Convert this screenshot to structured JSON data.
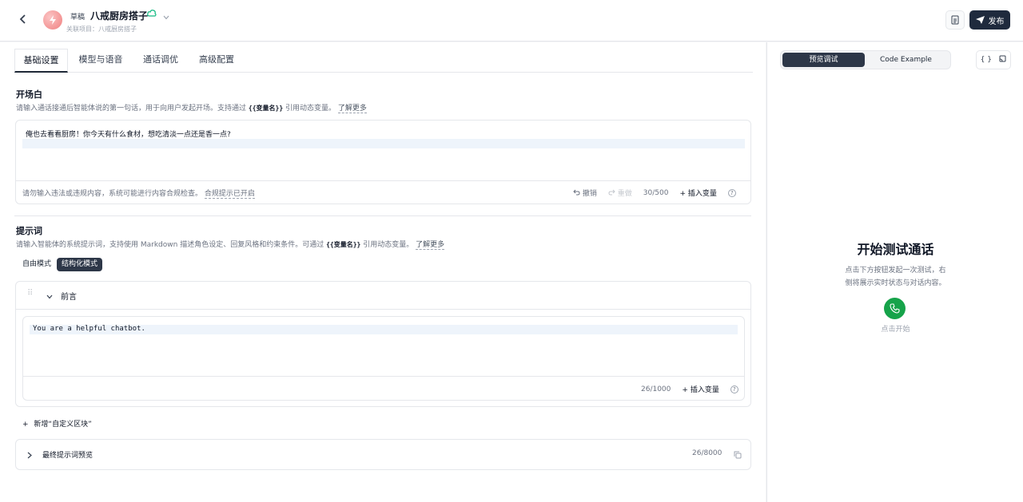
{
  "header": {
    "draft_badge": "草稿",
    "title": "八戒厨房搭子",
    "subtitle": "关联项目：八戒厨房搭子",
    "publish_label": "发布"
  },
  "tabs": [
    {
      "label": "基础设置",
      "active": true
    },
    {
      "label": "模型与语音",
      "active": false
    },
    {
      "label": "通话调优",
      "active": false
    },
    {
      "label": "高级配置",
      "active": false
    }
  ],
  "opening": {
    "title": "开场白",
    "desc_prefix": "请输入通话接通后智能体说的第一句话，用于向用户发起开场。支持通过",
    "var_syntax": "{{变量名}}",
    "desc_suffix": "引用动态变量。",
    "learn_more": "了解更多",
    "text": "俺也去看看厨房！你今天有什么食材，想吃清淡一点还是香一点?",
    "footer_note": "请勿输入违法或违规内容，系统可能进行内容合规检查。",
    "compliance_link": "合规提示已开启",
    "undo": "撤销",
    "redo": "重做",
    "count": "30/500",
    "insert_var": "插入变量"
  },
  "prompt": {
    "title": "提示词",
    "desc_prefix": "请输入智能体的系统提示词，支持使用 Markdown 描述角色设定、回复风格和约束条件。可通过",
    "var_syntax": "{{变量名}}",
    "desc_suffix": "引用动态变量。",
    "learn_more": "了解更多",
    "modes": [
      "自由模式",
      "结构化模式"
    ],
    "active_mode": "结构化模式",
    "block_title": "前言",
    "block_text": "You are a helpful chatbot.",
    "block_count": "26/1000",
    "insert_var": "插入变量",
    "add_block": "新增“自定义区块”",
    "preview_title": "最终提示词预览",
    "preview_count": "26/8000"
  },
  "right_panel": {
    "tabs": [
      "预览调试",
      "Code Example"
    ],
    "active_tab": "预览调试",
    "icon_labels": [
      "{ }"
    ],
    "heading": "开始测试通话",
    "desc_line1": "点击下方按钮发起一次测试，右",
    "desc_line2": "侧将展示实时状态与对话内容。",
    "start_label": "点击开始"
  },
  "colors": {
    "accent_dark": "#1f2a3d",
    "call_green": "#16a34a",
    "saved_green": "#10b981"
  }
}
